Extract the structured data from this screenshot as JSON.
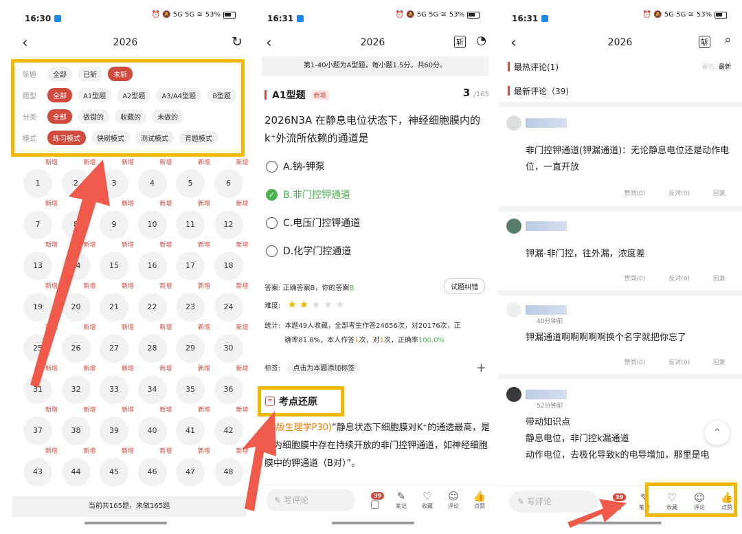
{
  "p1": {
    "time": "16:30",
    "battery": "53%",
    "title": "2026",
    "filters": [
      {
        "label": "斩题",
        "chips": [
          "全部",
          "已斩",
          "未斩"
        ],
        "active": 2
      },
      {
        "label": "题型",
        "chips": [
          "全部",
          "A1型题",
          "A2型题",
          "A3/A4型题",
          "B型题"
        ],
        "active": 0
      },
      {
        "label": "分类",
        "chips": [
          "全部",
          "做错的",
          "收藏的",
          "未做的"
        ],
        "active": 0
      },
      {
        "label": "模式",
        "chips": [
          "练习模式",
          "快刷模式",
          "测试模式",
          "背题模式"
        ],
        "active": 0
      }
    ],
    "new_tag": "新增",
    "numbers": [
      "1",
      "2",
      "3",
      "4",
      "5",
      "6",
      "7",
      "8",
      "9",
      "10",
      "11",
      "12",
      "13",
      "14",
      "15",
      "16",
      "17",
      "18",
      "19",
      "20",
      "21",
      "22",
      "23",
      "24",
      "25",
      "26",
      "27",
      "28",
      "29",
      "30",
      "31",
      "32",
      "33",
      "34",
      "35",
      "36",
      "37",
      "38",
      "39",
      "40",
      "41",
      "42",
      "43",
      "44",
      "45",
      "46",
      "47",
      "48"
    ],
    "footer": "当前共165题，未做165题"
  },
  "p2": {
    "time": "16:31",
    "battery": "53%",
    "title": "2026",
    "notice": "第1-40小题为A型题，每小题1.5分，共60分。",
    "qtype": "A1型题",
    "qtag": "新增",
    "qnum": "3",
    "qtotal": "/165",
    "stem": "2026N3A 在静息电位状态下，神经细胞膜内的k⁺外流所依赖的通道是",
    "options": [
      "A.钠-钾泵",
      "B.非门控钾通道",
      "C.电压门控钾通道",
      "D.化学门控通道"
    ],
    "answer_label": "答案:",
    "answer_pre": "正确答案B，你的答案",
    "answer_val": "B",
    "correct_btn": "试题纠错",
    "difficulty_label": "难度:",
    "stars": 2,
    "stats_label": "统计:",
    "stats_a": "本题49人收藏，全部考生作答24656次，对20176次，正",
    "stats_b": "确率81.8%，本人作答",
    "stats_n1": "1",
    "stats_c": "次，对",
    "stats_n2": "1",
    "stats_d": "次，正确率",
    "stats_rate": "100.0%",
    "tags_label": "标签:",
    "tags_btn": "点击为本题添加标签",
    "kd_title": "考点还原",
    "para_src": "10版生理学P30)",
    "para": "“静息状态下细胞膜对K⁺的通透最高，是因为细胞膜中存在持续开放的非门控钾通道，如神经细胞膜中的钾通道（B对）”。",
    "comment_ph": "写评论",
    "badge": "39",
    "actions": [
      "笔记",
      "收藏",
      "评论",
      "点赞"
    ]
  },
  "p3": {
    "time": "16:31",
    "battery": "53%",
    "title": "2026",
    "hot": "最热评论(1)",
    "sort_a": "最热",
    "sort_b": "最新",
    "latest": "最新评论（39)",
    "comments": [
      {
        "time": "",
        "text": "非门控钾通道(钾漏通道)：无论静息电位还是动作电位，一直开放"
      },
      {
        "time": "",
        "text": "钾漏-非门控，往外漏，浓度差"
      },
      {
        "time": "40分钟前",
        "text": "钾漏通道啊啊啊啊啊换个名字就把你忘了"
      },
      {
        "time": "52分钟前",
        "text": "带动知识点\n静息电位，非门控k漏通道\n动作电位，去极化导致k的电导增加，那里是电"
      }
    ],
    "c_actions": [
      "赞同(0)",
      "反对(0)",
      "回复"
    ],
    "comment_ph": "写评论",
    "badge": "39",
    "actions": [
      "笔记",
      "收藏",
      "评论",
      "点赞"
    ]
  }
}
